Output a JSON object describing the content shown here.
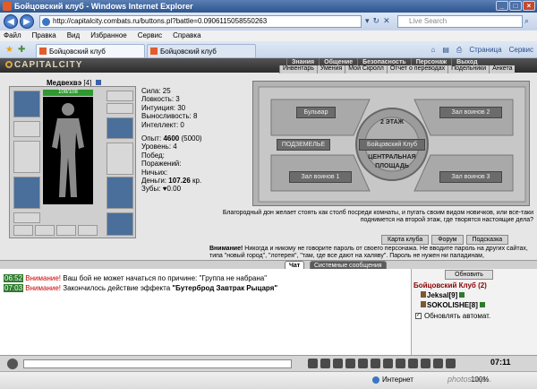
{
  "window": {
    "title": "Бойцовский клуб - Windows Internet Explorer",
    "url": "http://capitalcity.combats.ru/buttons.pl?battle=0.0906115058550263",
    "search_placeholder": "Live Search"
  },
  "menu": [
    "Файл",
    "Правка",
    "Вид",
    "Избранное",
    "Сервис",
    "Справка"
  ],
  "tabs": [
    {
      "label": "Бойцовский клуб",
      "active": true
    },
    {
      "label": "Бойцовский клуб",
      "active": false
    }
  ],
  "toolbar_right": {
    "page": "Страница",
    "tools": "Сервис"
  },
  "game": {
    "logo": "CAPITALCITY",
    "nav": [
      "Знания",
      "Общение",
      "Безопасность",
      "Персонаж",
      "Выход"
    ],
    "subnav": [
      "Инвентарь",
      "Умения",
      "Мой Скролл",
      "Отчет о переводах",
      "Подельники",
      "Анкета"
    ]
  },
  "character": {
    "name": "Медвехвэ",
    "level": "[4]",
    "hp": "108/108",
    "stats": {
      "strength": "Сила: 25",
      "agility": "Ловкость: 3",
      "intuition": "Интуиция: 30",
      "endurance": "Выносливость: 8",
      "intellect": "Интеллект: 0"
    },
    "exp_label": "Опыт:",
    "exp_value": "4600",
    "exp_next": "(5000)",
    "level_line": "Уровень: 4",
    "wins": "Побед:",
    "losses": "Поражений:",
    "draws": "Ничьих:",
    "money_label": "Деньги:",
    "money_value": "107.26",
    "money_unit": "кр.",
    "teeth_label": "Зубы:",
    "teeth_value": "0.00"
  },
  "map": {
    "buttons": {
      "boulevard": "Бульвар",
      "hall2": "Зал воинов 2",
      "floor2": "2 ЭТАЖ",
      "basement": "ПОДЗЕМЕЛЬЕ",
      "club": "Бойцовский Клуб",
      "square_line1": "ЦЕНТРАЛЬНАЯ",
      "square_line2": "ПЛОЩАДЬ",
      "hall1": "Зал воинов 1",
      "hall3": "Зал воинов 3"
    },
    "description": "Благородный дон желает стоять как столб посреди комнаты, и пугать своим видом новичков, или все-таки поднимется на второй этаж, где творятся настоящие дела?"
  },
  "links": [
    "Карта клуба",
    "Форум",
    "Подсказка"
  ],
  "warning": {
    "prefix": "Внимание!",
    "text": "Никогда и никому не говорите пароль от своего персонажа. Не вводите пароль на других сайтах, типа \"новый город\", \"лотерея\", \"там, где все дают на халяву\". Пароль не нужен ни паладинам,"
  },
  "chat": {
    "tabs": [
      "Чат",
      "Системные сообщения"
    ],
    "lines": [
      {
        "time": "06:52",
        "attn": "Внимание!",
        "text": "Ваш бой не может начаться по причине: \"Группа не набрана\""
      },
      {
        "time": "07:03",
        "attn": "Внимание!",
        "text": "Закончилось действие эффекта ",
        "bold": "\"Бутерброд Завтрак Рыцаря\""
      }
    ],
    "clock": "07:11"
  },
  "sidebar": {
    "refresh": "Обновить",
    "club": "Бойцовский Клуб (2)",
    "members": [
      {
        "name": "Jeksal",
        "level": "[9]"
      },
      {
        "name": "SOKOLISHE",
        "level": "[8]"
      }
    ],
    "auto_refresh": "Обновлять автомат."
  },
  "statusbar": {
    "zone": "Интернет",
    "zoom": "100%"
  },
  "watermark": "photoshop...",
  "colors": {
    "titlebar": "#2e548f",
    "game_header": "#2b2b2b",
    "hp_bar": "#2e9a2e",
    "attention": "#cc0000",
    "club_title": "#8b0000"
  }
}
